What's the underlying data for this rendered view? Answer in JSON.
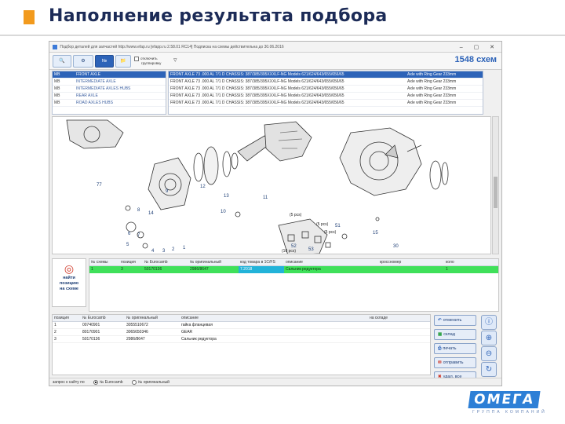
{
  "slide": {
    "title": "Наполнение результата подбора"
  },
  "window": {
    "title": "Подбор деталей для запчастей http://www.efap.ru [efapp.ru 2.58.01 RC14]  Подписка на схемы действительна до 30.06.2016",
    "controls": "‒ ▢ ✕"
  },
  "toolbar": {
    "check_label_1": "отключить",
    "check_label_2": "группировку",
    "scheme_count": "1548 схем"
  },
  "groups": [
    {
      "code": "MB",
      "name": "FRONT AXLE",
      "selected": true
    },
    {
      "code": "MB",
      "name": "INTERMEDIATE AXLE"
    },
    {
      "code": "MB",
      "name": "INTERMEDIATE AXLES HUBS"
    },
    {
      "code": "MB",
      "name": "REAR AXLE"
    },
    {
      "code": "MB",
      "name": "ROAD AXLES HUBS"
    }
  ],
  "schemes": [
    {
      "name": "FRONT AXLE 73 .000 AL 7/1 D CHASSIS: 387/385/395XXXLF-NG Models 621/624/643/655/656/65",
      "ring": "Axle with Ring Gear 233mm",
      "selected": true
    },
    {
      "name": "FRONT AXLE 73 .000 AL 7/1 D CHASSIS: 387/385/395XXXLF-NG Models 621/624/643/655/656/65",
      "ring": "Axle with Ring Gear 233mm"
    },
    {
      "name": "FRONT AXLE 73 .000 AL 7/1 D CHASSIS: 387/385/395XXXLF-NG Models 621/624/643/655/656/65",
      "ring": "Axle with Ring Gear 233mm"
    },
    {
      "name": "FRONT AXLE 73 .000 AL 7/1 D CHASSIS: 387/385/395XXXLF-NG Models 621/624/643/655/656/65",
      "ring": "Axle with Ring Gear 233mm"
    },
    {
      "name": "FRONT AXLE 73 .000 AL 7/1 D CHASSIS: 387/385/395XXXLF-NG Models 621/624/643/655/656/65",
      "ring": "Axle with Ring Gear 233mm"
    }
  ],
  "diagram": {
    "callouts": [
      "77",
      "9",
      "12",
      "13",
      "11",
      "8",
      "10",
      "14",
      "6",
      "7",
      "5",
      "4",
      "3",
      "2",
      "1",
      "15",
      "30",
      "51",
      "52",
      "53"
    ],
    "qty_labels": [
      "(5 pcs)",
      "(5 pcs)",
      "(5 pcs)",
      "(10 pcs)"
    ]
  },
  "find": {
    "line1": "найти",
    "line2": "позицию",
    "line3": "на схеме"
  },
  "parts_table": {
    "headers": [
      "№ схемы",
      "позиция",
      "№ Eurocamb",
      "№ оригинальный",
      "код товара в 1С/FS",
      "описание",
      "кроссномер",
      "коло"
    ],
    "row": [
      "1",
      "3",
      "50170136",
      "2986/8647",
      "7.2018",
      "Сальник редуктора",
      "",
      "1"
    ]
  },
  "bottom_table": {
    "headers": [
      "позиция",
      "№ Eurocamb",
      "№ оригинальный",
      "описание",
      "",
      "на складе"
    ],
    "rows": [
      [
        "1",
        "00740901",
        "3055510672",
        "гайка фланцевая",
        "",
        ""
      ],
      [
        "2",
        "80170901",
        "3065650346",
        "GEAR",
        "",
        ""
      ],
      [
        "3",
        "50170136",
        "2986/8647",
        "Сальник редуктора",
        "",
        ""
      ]
    ]
  },
  "actions": [
    {
      "label": "отменить",
      "icon": "arrow-left-icon"
    },
    {
      "label": "склад",
      "icon": "warehouse-icon"
    },
    {
      "label": "печать",
      "icon": "print-icon"
    },
    {
      "label": "отправить",
      "icon": "send-icon"
    },
    {
      "label": "удал. все",
      "icon": "delete-icon"
    }
  ],
  "status": {
    "label": "запрос к сайту по",
    "opt1": "№ Eurocamb",
    "opt2": "№ оригинальный"
  },
  "logo": {
    "word": "ОМЕГА",
    "tagline": "ГРУППА КОМПАНИЙ"
  },
  "colors": {
    "accent": "#2d63b8",
    "selected_row": "#3fe05a",
    "code_cell": "#22b3d9",
    "brand_orange": "#f29a1d",
    "title_navy": "#1c2b57"
  }
}
